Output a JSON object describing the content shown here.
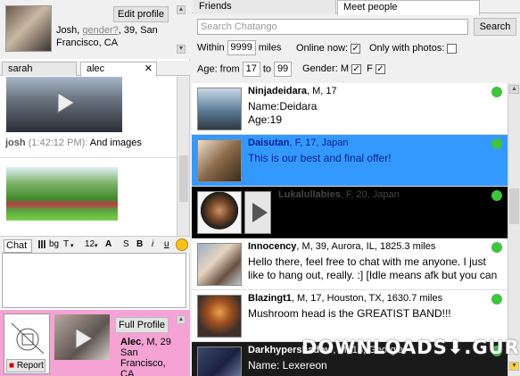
{
  "profile": {
    "edit_label": "Edit profile",
    "name": "Josh, ",
    "gender": "gender?",
    "age_loc": ", 39, San Francisco, CA"
  },
  "chat_tabs": [
    {
      "label": "sarah"
    },
    {
      "label": "alec"
    }
  ],
  "chat": {
    "sender": "josh",
    "time": " (1:42:12 PM): ",
    "text": "And images",
    "label": "Chat"
  },
  "toolbar": {
    "bg": "bg",
    "t": "T",
    "size": "12",
    "s": "S",
    "b": "B",
    "i": "i",
    "u": "u"
  },
  "mini_profile": {
    "full_label": "Full Profile",
    "name": "Alec",
    "info": ", M, 29",
    "loc1": "San",
    "loc2": "Francisco,",
    "loc3": "CA",
    "report": "Report"
  },
  "right_tabs": [
    {
      "label": "Friends"
    },
    {
      "label": "Meet people"
    }
  ],
  "search": {
    "placeholder": "Search Chatango",
    "button": "Search"
  },
  "filters": {
    "within_label": "Within",
    "within_value": "9999",
    "miles_label": "miles",
    "online_label": "Online now:",
    "online_checked": "✓",
    "photos_label": "Only with photos:",
    "age_label": "Age: from",
    "age_from": "17",
    "to_label": "to",
    "age_to": "99",
    "gender_label": "Gender:",
    "m_label": "M",
    "m_checked": "✓",
    "f_label": "F",
    "f_checked": "✓"
  },
  "users": [
    {
      "name": "Ninjadeidara",
      "info": ", M, 17",
      "line1": "Name:Deidara",
      "line2": "Age:19"
    },
    {
      "name": "Daisutan",
      "info": ", F, 17, Japan",
      "line1": "This is our best and final offer!",
      "line2": ""
    },
    {
      "name": "Lukalullabies",
      "info": ", F, 20, Japan",
      "line1": "",
      "line2": ""
    },
    {
      "name": "Innocency",
      "info": ", M, 39, Aurora, IL, 1825.3 miles",
      "line1": "Hello there, feel free to chat with me anyone. I  just",
      "line2": "like to hang out, really. :] [Idle means afk but you can"
    },
    {
      "name": "Blazingt1",
      "info": ", M, 17, Houston, TX, 1630.7 miles",
      "line1": "Mushroom head is the GREATIST BAND!!!",
      "line2": ""
    },
    {
      "name": "Darkhypershadow",
      "info": ", M, 18, Georgia",
      "line1": "Name: Lexereon",
      "line2": ""
    }
  ],
  "watermark": "DOWNLOADS⬇.GURU",
  "colors": {
    "selected_row": "#3399ff",
    "dark_row": "#000000",
    "online_dot": "#3ec43e",
    "pink_panel": "#f4a3d4",
    "scroll_arrow": "#ffd23f"
  }
}
